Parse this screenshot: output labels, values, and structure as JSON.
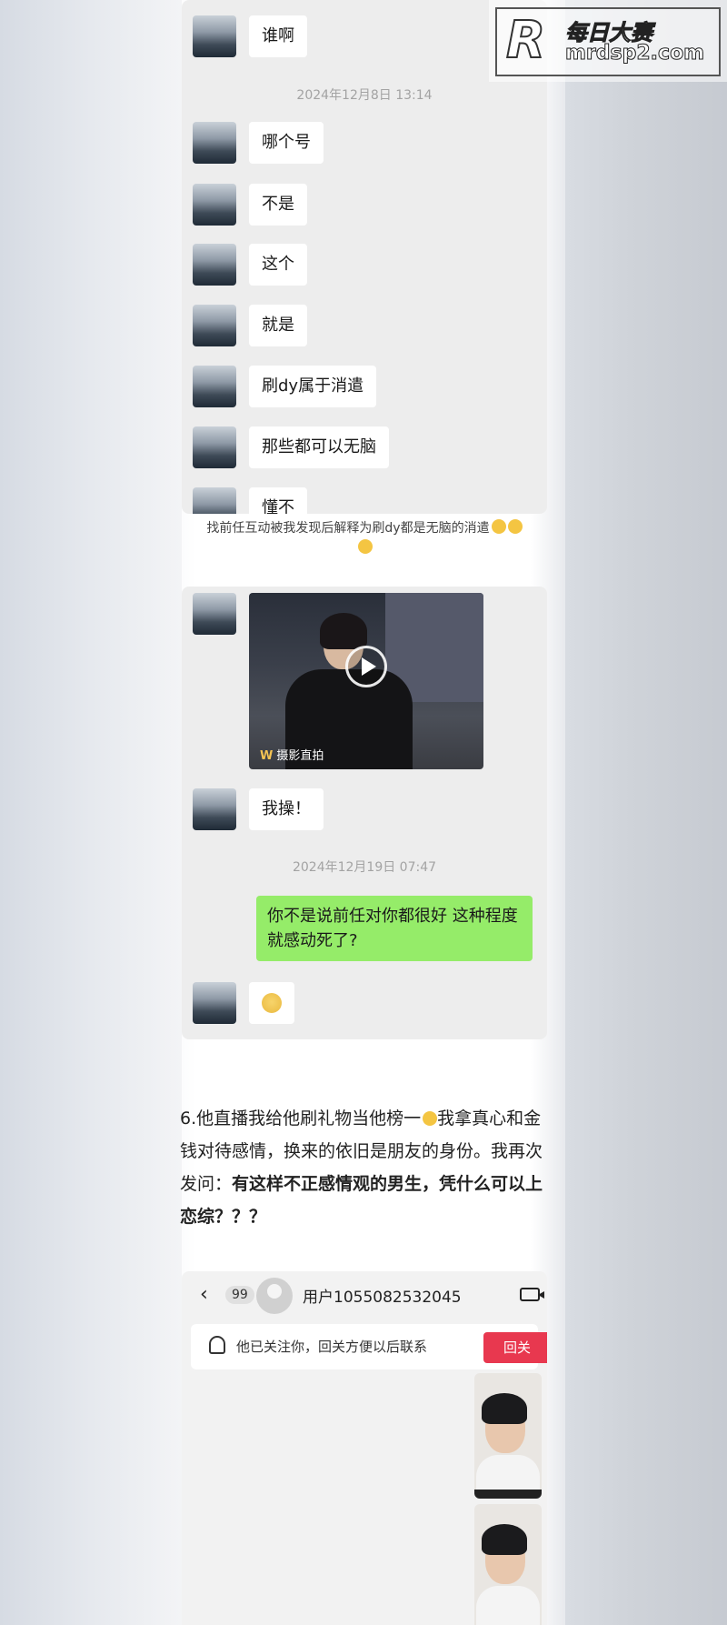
{
  "watermark": {
    "cn": "每日大赛",
    "url": "mrdsp2.com"
  },
  "chat1": {
    "messages": [
      "谁啊",
      "哪个号",
      "不是",
      "这个",
      "就是",
      "刷dy属于消遣",
      "那些都可以无脑",
      "懂不"
    ],
    "timestamp": "2024年12月8日 13:14"
  },
  "caption": "找前任互动被我发现后解释为刷dy都是无脑的消遣",
  "chat2": {
    "video_label": "摄影直拍",
    "messages": [
      "我操！"
    ],
    "timestamp": "2024年12月19日 07:47",
    "sent": "你不是说前任对你都很好 这种程度就感动死了?"
  },
  "article": {
    "p1": "6.他直播我给他刷礼物当他榜一",
    "p2": "我拿真心和金钱对待感情，换来的依旧是朋友的身份。我再次发问：",
    "p3_bold": "有这样不正感情观的男生，凭什么可以上恋综？？？"
  },
  "dm": {
    "unread": "99",
    "username": "用户1055082532045",
    "notice": "他已关注你，回关方便以后联系",
    "follow_back": "回关"
  }
}
